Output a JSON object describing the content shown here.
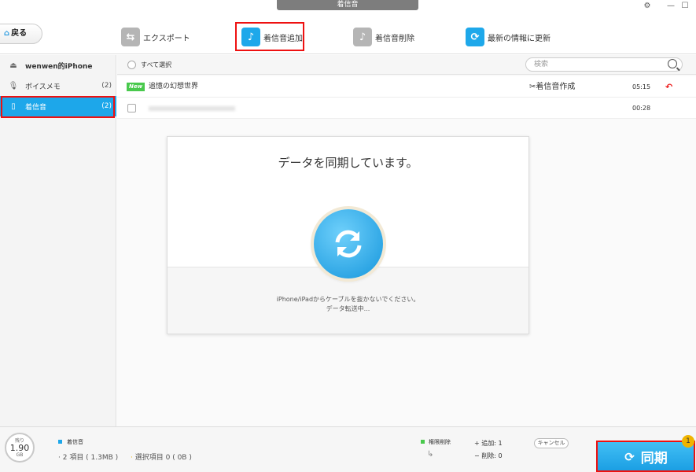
{
  "window": {
    "title": "着信音"
  },
  "toolbar": {
    "back_label": "戻る",
    "export_label": "エクスポート",
    "add_label": "着信音追加",
    "delete_label": "着信音削除",
    "refresh_label": "最新の情報に更新"
  },
  "sidebar": {
    "device": "wenwen的iPhone",
    "items": [
      {
        "label": "ボイスメモ",
        "count": "(2)"
      },
      {
        "label": "着信音",
        "count": "(2)"
      }
    ]
  },
  "list": {
    "select_all": "すべて選択",
    "search_placeholder": "検索",
    "rows": [
      {
        "badge": "New",
        "title": "追憶の幻想世界",
        "action": "着信音作成",
        "duration": "05:15"
      },
      {
        "title": "",
        "duration": "00:28"
      }
    ]
  },
  "dialog": {
    "title": "データを同期しています。",
    "line1": "iPhone/iPadからケーブルを抜かないでください。",
    "line2": "データ転送中..."
  },
  "footer": {
    "storage_caption": "残り",
    "storage_value": "1.90",
    "storage_unit": "GB",
    "category": "着信音",
    "items_info": "2 項目 ( 1.3MB )",
    "selected_info": "選択項目 0 ( 0B )",
    "perm_delete": "権限削除",
    "add_label": "追加:",
    "add_count": "1",
    "delete_label": "削除:",
    "delete_count": "0",
    "cancel_label": "キャンセル",
    "sync_label": "同期",
    "sync_badge": "1"
  }
}
